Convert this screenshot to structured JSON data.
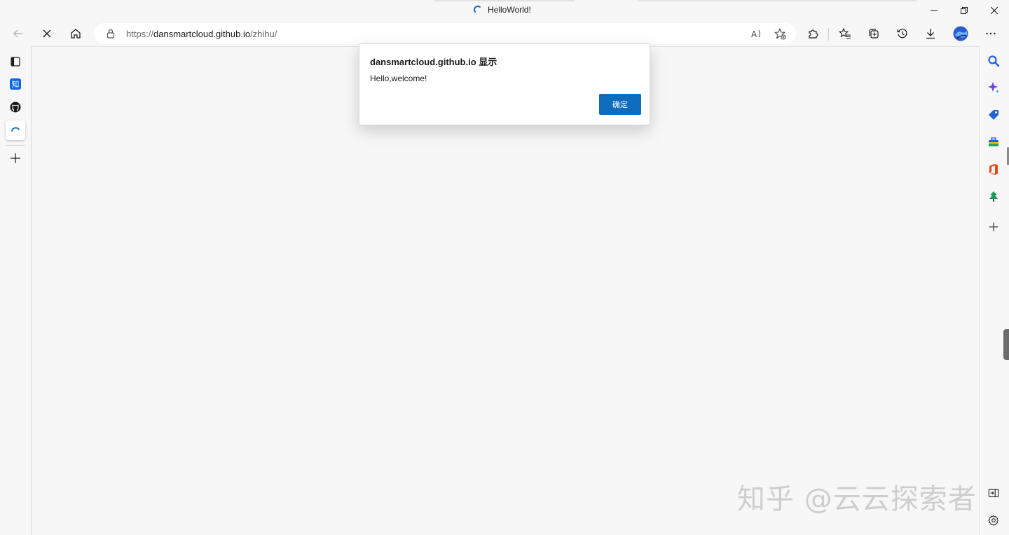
{
  "window": {
    "title": "HelloWorld!",
    "controls": {
      "minimize_icon": "minimize-icon",
      "restore_icon": "restore-icon",
      "close_icon": "close-icon"
    }
  },
  "toolbar": {
    "address": {
      "scheme": "https://",
      "host": "dansmartcloud.github.io",
      "path": "/zhihu/"
    },
    "buttons": [
      "back-icon",
      "stop-icon",
      "home-icon",
      "read-aloud-icon",
      "add-favorite-icon",
      "extensions-icon",
      "favorites-icon",
      "collections-icon",
      "history-icon",
      "downloads-icon",
      "profile-icon",
      "more-icon"
    ]
  },
  "vertical_tabs": {
    "items": [
      {
        "icon": "tab-actions-icon"
      },
      {
        "icon": "zhihu-icon",
        "glyph": "知"
      },
      {
        "icon": "github-icon"
      },
      {
        "icon": "loading-icon",
        "active": true
      },
      {
        "icon": "new-tab-icon"
      }
    ]
  },
  "sidebar": {
    "items": [
      "search-icon",
      "copilot-icon",
      "shopping-icon",
      "tools-icon",
      "office-icon",
      "games-icon",
      "add-icon",
      "hide-sidebar-icon",
      "settings-icon"
    ]
  },
  "dialog": {
    "title": "dansmartcloud.github.io 显示",
    "message": "Hello,welcome!",
    "ok_label": "确定"
  },
  "watermark": {
    "text": "知乎 @云云探索者"
  },
  "colors": {
    "accent": "#0f6cbd",
    "background": "#f7f7f7"
  }
}
